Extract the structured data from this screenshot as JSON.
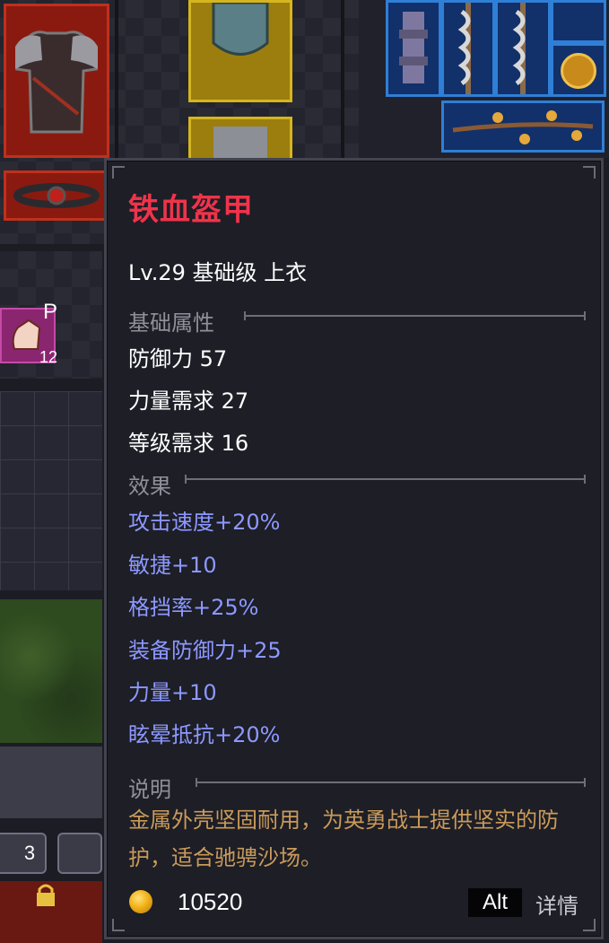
{
  "background": {
    "skill_key": "P",
    "skill_level": "12",
    "hotkey_count": "3"
  },
  "tooltip": {
    "item_name": "铁血盔甲",
    "item_info": "Lv.29 基础级 上衣",
    "base_section": "基础属性",
    "base_stats": [
      "防御力 57",
      "力量需求 27",
      "等级需求 16"
    ],
    "effect_section": "效果",
    "effects": [
      "攻击速度+20%",
      "敏捷+10",
      "格挡率+25%",
      "装备防御力+25",
      "力量+10",
      "眩晕抵抗+20%"
    ],
    "desc_section": "说明",
    "description": "金属外壳坚固耐用，为英勇战士提供坚实的防护，适合驰骋沙场。",
    "price": "10520",
    "alt_key": "Alt",
    "alt_label": "详情"
  },
  "colors": {
    "item_name": "#f0334a",
    "effect_text": "#8d98ff",
    "description_text": "#c99a5a",
    "section_header": "#8f909a"
  },
  "icons": [
    "armor-icon",
    "belt-icon",
    "shoulder-guard-icon",
    "totem-icon",
    "staff-icon",
    "gold-coin-icon",
    "branch-icon",
    "skill-hand-icon",
    "lock-icon"
  ]
}
